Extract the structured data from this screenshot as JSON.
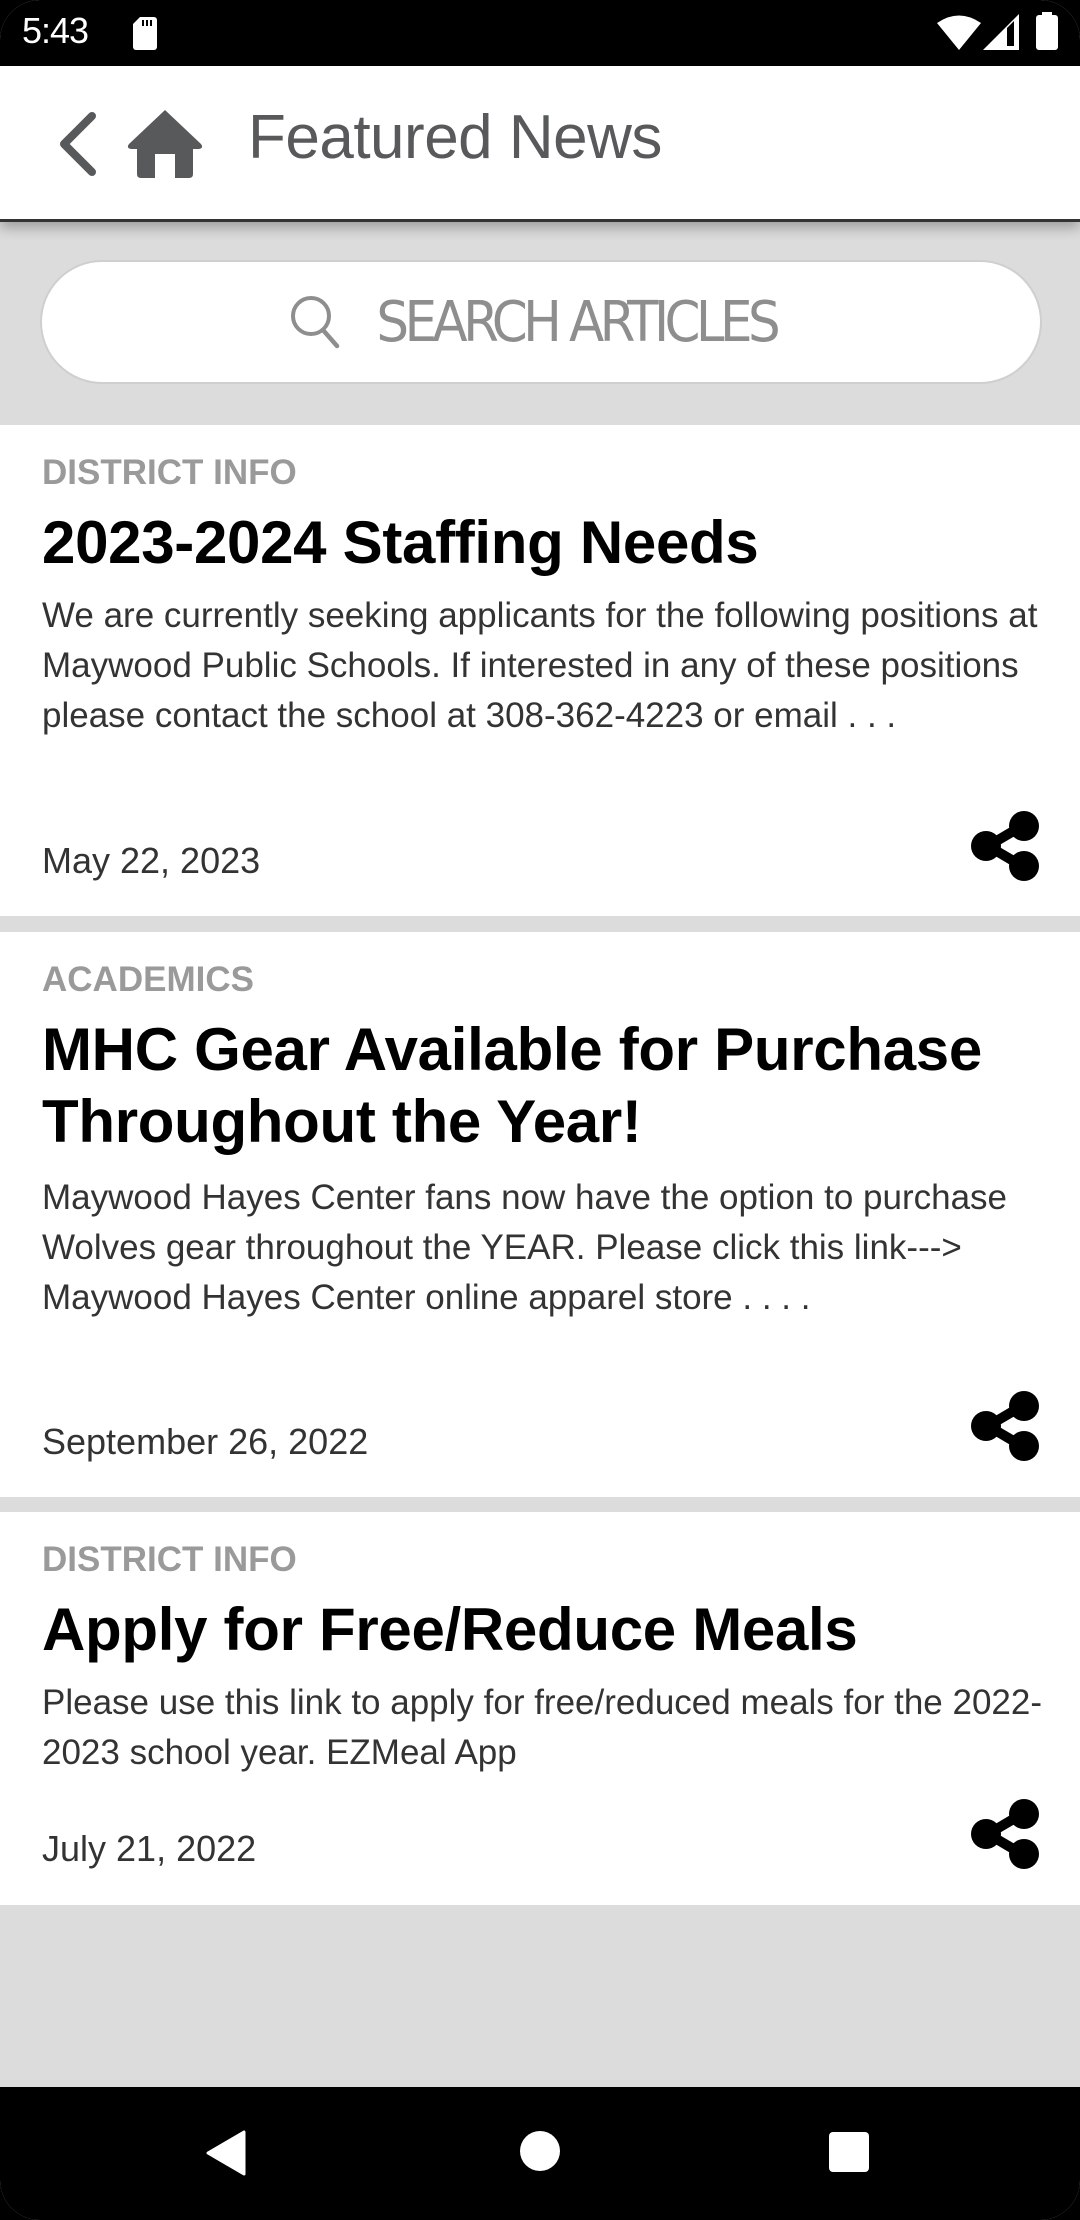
{
  "status_bar": {
    "time": "5:43",
    "icons": [
      "sd-card-icon",
      "wifi-icon",
      "signal-icon",
      "battery-icon"
    ]
  },
  "header": {
    "title": "Featured News",
    "back_icon": "chevron-left-icon",
    "home_icon": "home-icon"
  },
  "search": {
    "placeholder": "SEARCH ARTICLES",
    "icon": "search-icon"
  },
  "articles": [
    {
      "category": "DISTRICT INFO",
      "title": "2023-2024 Staffing Needs",
      "excerpt": "We are currently seeking applicants for the following positions at Maywood Public Schools.  If interested in any of these positions please contact the school at 308-362-4223 or email . . .",
      "date": "May 22, 2023",
      "share_icon": "share-icon"
    },
    {
      "category": "ACADEMICS",
      "title": "MHC Gear Available for Purchase Throughout the Year!",
      "excerpt": "Maywood Hayes Center fans now have the option to purchase Wolves gear throughout the YEAR.  Please click this link--->  Maywood Hayes Center online apparel store . . . .",
      "date": "September 26, 2022",
      "share_icon": "share-icon"
    },
    {
      "category": "DISTRICT INFO",
      "title": "Apply for Free/Reduce Meals",
      "excerpt": "Please use this link to apply for free/reduced meals for the 2022-2023 school year.   EZMeal App",
      "date": "July 21, 2022",
      "share_icon": "share-icon"
    }
  ],
  "nav_bar": {
    "buttons": [
      "back",
      "home",
      "recents"
    ]
  },
  "colors": {
    "header_text": "#58595b",
    "category_text": "#9a9a9a",
    "background_gray": "#dcdcdc",
    "body_text": "#333333"
  }
}
